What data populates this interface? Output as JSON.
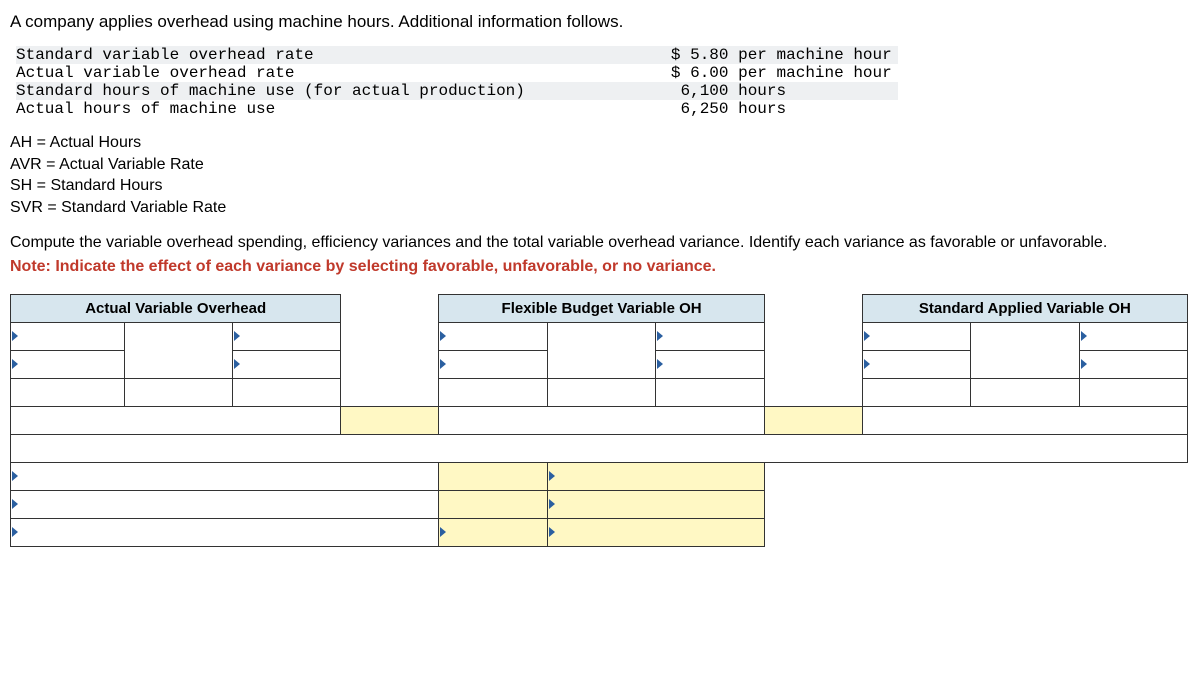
{
  "question": "A company applies overhead using machine hours. Additional information follows.",
  "info_rows": [
    {
      "label": "Standard variable overhead rate",
      "value": "$ 5.80 per machine hour"
    },
    {
      "label": "Actual variable overhead rate",
      "value": "$ 6.00 per machine hour"
    },
    {
      "label": "Standard hours of machine use (for actual production)",
      "value": " 6,100 hours"
    },
    {
      "label": "Actual hours of machine use",
      "value": " 6,250 hours"
    }
  ],
  "legend": [
    "AH = Actual Hours",
    "AVR = Actual Variable Rate",
    "SH = Standard Hours",
    "SVR = Standard Variable Rate"
  ],
  "compute_text": "Compute the variable overhead spending, efficiency variances and the total variable overhead variance. Identify each variance as favorable or unfavorable.",
  "note_text": "Note: Indicate the effect of each variance by selecting favorable, unfavorable, or no variance.",
  "headers": {
    "col1": "Actual Variable Overhead",
    "col2": "Flexible Budget Variable OH",
    "col3": "Standard Applied Variable OH"
  }
}
